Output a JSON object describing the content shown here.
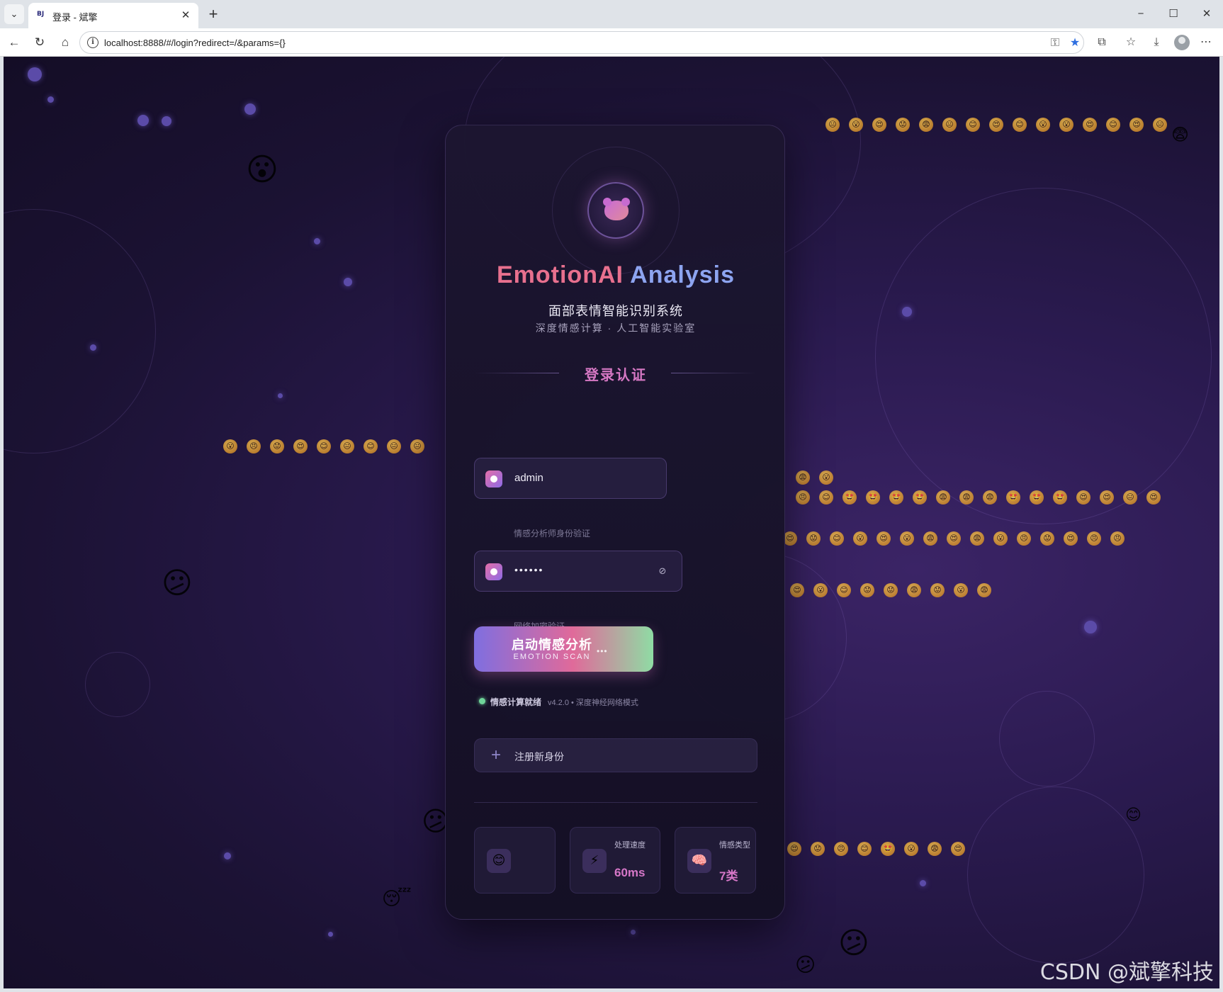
{
  "browser": {
    "tab_title": "登录 - 斌擎",
    "favicon_text": "BJ",
    "url": "localhost:8888/#/login?redirect=/&params={}"
  },
  "card": {
    "brand_part1": "EmotionAI",
    "brand_part2": "Analysis",
    "subtitle": "面部表情智能识别系统",
    "tagline": "深度情感计算 · 人工智能实验室",
    "section_title": "登录认证",
    "username": {
      "value": "admin",
      "hint": "情感分析师身份验证"
    },
    "password": {
      "masked_value": "••••••",
      "hint": "网络加密验证..."
    },
    "launch": {
      "label": "启动情感分析",
      "sublabel": "EMOTION SCAN",
      "dots": "•••"
    },
    "status": {
      "text": "情感计算就绪",
      "meta": "v4.2.0 • 深度神经网络模式"
    },
    "register_label": "注册新身份",
    "stats": [
      {
        "icon": "😊",
        "icon_name": "smile-face-icon",
        "label": "",
        "value": ""
      },
      {
        "icon": "⚡",
        "icon_name": "lightning-icon",
        "label": "处理速度",
        "value": "60ms"
      },
      {
        "icon": "🧠",
        "icon_name": "brain-icon",
        "label": "情感类型",
        "value": "7类"
      }
    ]
  },
  "watermark": "CSDN @斌擎科技",
  "colors": {
    "accent_pink": "#e8708e",
    "accent_blue": "#8da4f0",
    "section_pink": "#d678c4",
    "status_green": "#6fd59a",
    "background_deep": "#1b1233"
  }
}
